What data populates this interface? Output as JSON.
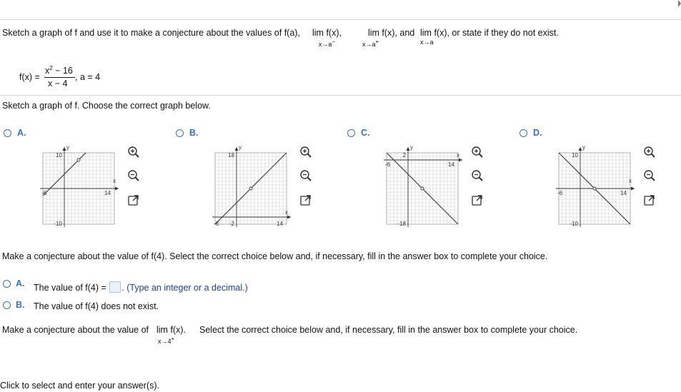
{
  "question": {
    "prompt_start": "Sketch a graph of f and use it to make a conjecture about the values of f(a),",
    "lim1_word": "lim f(x),",
    "lim1_sub": "x→a",
    "lim1_sup": "−",
    "lim2_word": "lim f(x), and",
    "lim2_sub": "x→a",
    "lim2_sup": "+",
    "lim3_word": "lim f(x), or state if they do not exist.",
    "lim3_sub": "x→a"
  },
  "function": {
    "lhs": "f(x) =",
    "numerator": "x",
    "numerator_exp": "2",
    "numerator_rest": " − 16",
    "denominator": "x − 4",
    "param": ", a = 4"
  },
  "sketch_prompt": "Sketch a graph of f. Choose the correct graph below.",
  "graph_options": [
    {
      "label": "A.",
      "ticks": {
        "top": "10",
        "bottom": "-10",
        "left": "-6",
        "right": "14",
        "xaxis": "x",
        "yaxis": "y"
      }
    },
    {
      "label": "B.",
      "ticks": {
        "top": "18",
        "bottom": "-2",
        "left": "-6",
        "right": "14",
        "xaxis": "x",
        "yaxis": "y"
      }
    },
    {
      "label": "C.",
      "ticks": {
        "top": "2",
        "bottom": "-18",
        "left": "-6",
        "right": "14",
        "xaxis": "x",
        "yaxis": "y"
      }
    },
    {
      "label": "D.",
      "ticks": {
        "top": "10",
        "bottom": "-10",
        "left": "-6",
        "right": "14",
        "xaxis": "x",
        "yaxis": "y"
      }
    }
  ],
  "icons": {
    "zoom_in": "zoom-in-icon",
    "zoom_out": "zoom-out-icon",
    "popout": "popout-icon"
  },
  "conjecture_f4": {
    "prompt": "Make a conjecture about the value of f(4). Select the correct choice below and, if necessary, fill in the answer box to complete your choice.",
    "choice_a_label": "A.",
    "choice_a_text": "The value of f(4) =",
    "choice_a_hint": ". (Type an integer or a decimal.)",
    "choice_b_label": "B.",
    "choice_b_text": "The value of f(4) does not exist."
  },
  "conjecture_lim": {
    "prompt_start": "Make a conjecture about the value of",
    "lim_word": "lim f(x).",
    "lim_sub": "x→4",
    "lim_sup": "+",
    "prompt_end": "Select the correct choice below and, if necessary, fill in the answer box to complete your choice."
  },
  "footer": "Click to select and enter your answer(s).",
  "colors": {
    "accent": "#3a6fc8",
    "rule": "#d9d9d9",
    "hint": "#1e3f9e"
  }
}
